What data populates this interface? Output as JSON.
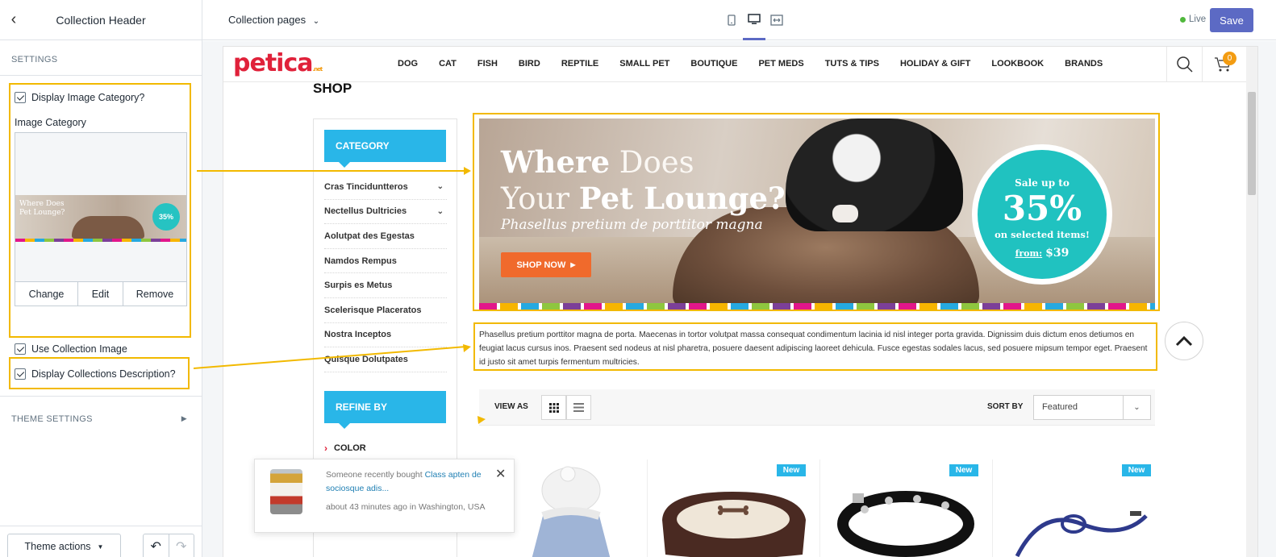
{
  "editor": {
    "title": "Collection Header",
    "settings_label": "SETTINGS",
    "display_image_category": "Display Image Category?",
    "image_category_label": "Image Category",
    "thumb_title_1": "Where Does",
    "thumb_title_2": "Pet Lounge?",
    "thumb_badge": "35%",
    "image_actions": [
      "Change",
      "Edit",
      "Remove"
    ],
    "use_collection_image": "Use Collection Image",
    "display_collections_description": "Display Collections Description?",
    "theme_settings_label": "THEME SETTINGS",
    "theme_actions_label": "Theme actions"
  },
  "topbar": {
    "page_select": "Collection pages",
    "live_label": "Live",
    "save_label": "Save",
    "colors": {
      "accent": "#5c6ac4",
      "live": "#50b83c"
    }
  },
  "store": {
    "logo": "petica",
    "logo_suffix": ".net",
    "nav": [
      "DOG",
      "CAT",
      "FISH",
      "BIRD",
      "REPTILE",
      "SMALL PET",
      "BOUTIQUE",
      "PET MEDS",
      "TUTS & TIPS",
      "HOLIDAY & GIFT",
      "LOOKBOOK",
      "BRANDS"
    ],
    "cart_count": "0",
    "shop_title": "SHOP",
    "category_heading": "CATEGORY",
    "categories": [
      "Cras Tinciduntteros",
      "Nectellus Dultricies",
      "Aolutpat des Egestas",
      "Namdos Rempus",
      "Surpis es Metus",
      "Scelerisque Placeratos",
      "Nostra Inceptos",
      "Quisque Dolutpates"
    ],
    "refine_heading": "REFINE BY",
    "refine_color": "COLOR",
    "banner": {
      "title_a": "Where",
      "title_b": "Does",
      "title_c": "Your",
      "title_d": "Pet Lounge?",
      "subtitle": "Phasellus pretium de porttitor magna",
      "cta": "SHOP NOW",
      "badge_top": "Sale up to",
      "badge_pct": "35%",
      "badge_mid": "on selected items!",
      "badge_from": "from:",
      "badge_price": "$39"
    },
    "description": "Phasellus pretium porttitor magna de porta. Maecenas in tortor volutpat massa consequat condimentum lacinia id nisl integer porta gravida. Dignissim duis dictum enos detiumos en feugiat lacus cursus inos. Praesent sed nodeus at nisl pharetra, posuere daesent adipiscing laoreet dehicula. Fusce egestas sodales lacus, sed posuere mipsum tempor eget. Praesent id justo sit amet turpis fermentum multricies.",
    "view_as": "VIEW AS",
    "sort_by": "SORT BY",
    "sort_value": "Featured",
    "new_badge": "New",
    "colors": {
      "brand": "#e0213a",
      "accent_blue": "#29b6e8",
      "cta": "#f06a2c",
      "badge": "#20c2c0",
      "highlight": "#f2b900"
    }
  },
  "toast": {
    "prefix": "Someone recently bought",
    "product": "Class apten de sociosque adis...",
    "when": "about 43 minutes ago in Washington, USA"
  }
}
